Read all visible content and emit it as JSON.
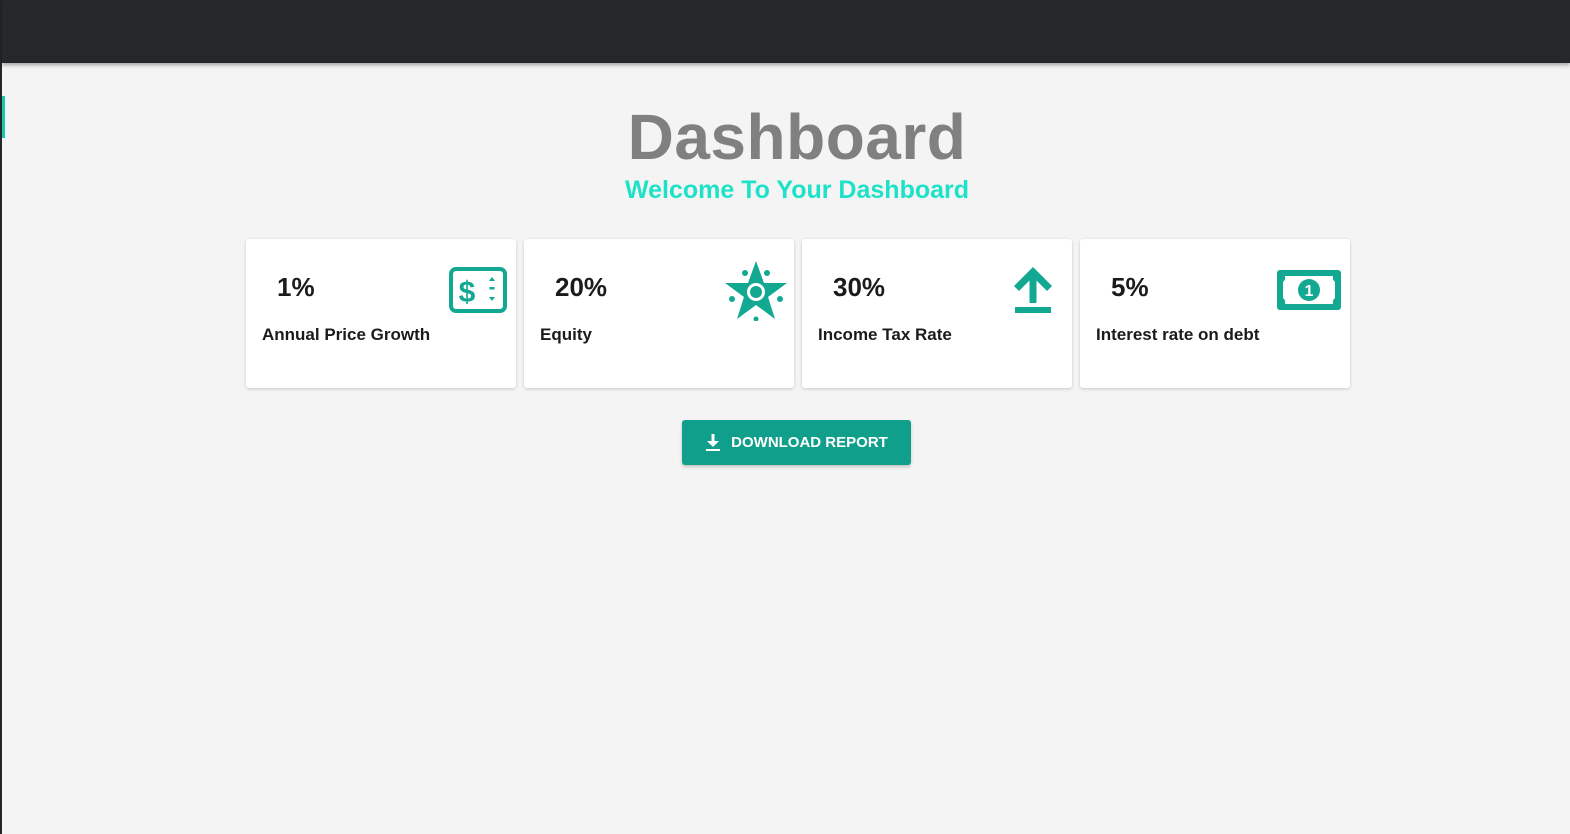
{
  "header": {
    "title": "Dashboard",
    "subtitle": "Welcome To Your Dashboard"
  },
  "cards": [
    {
      "value": "1%",
      "label": "Annual Price Growth",
      "icon": "money-check-icon"
    },
    {
      "value": "20%",
      "label": "Equity",
      "icon": "star-network-icon"
    },
    {
      "value": "30%",
      "label": "Income Tax Rate",
      "icon": "upload-icon"
    },
    {
      "value": "5%",
      "label": "Interest rate on debt",
      "icon": "banknote-icon"
    }
  ],
  "download_button": {
    "label": "DOWNLOAD REPORT",
    "icon": "download-icon"
  },
  "colors": {
    "accent": "#1de2c8",
    "icon": "#12a892",
    "button": "#0f9f8a",
    "topbar": "#24282a"
  }
}
